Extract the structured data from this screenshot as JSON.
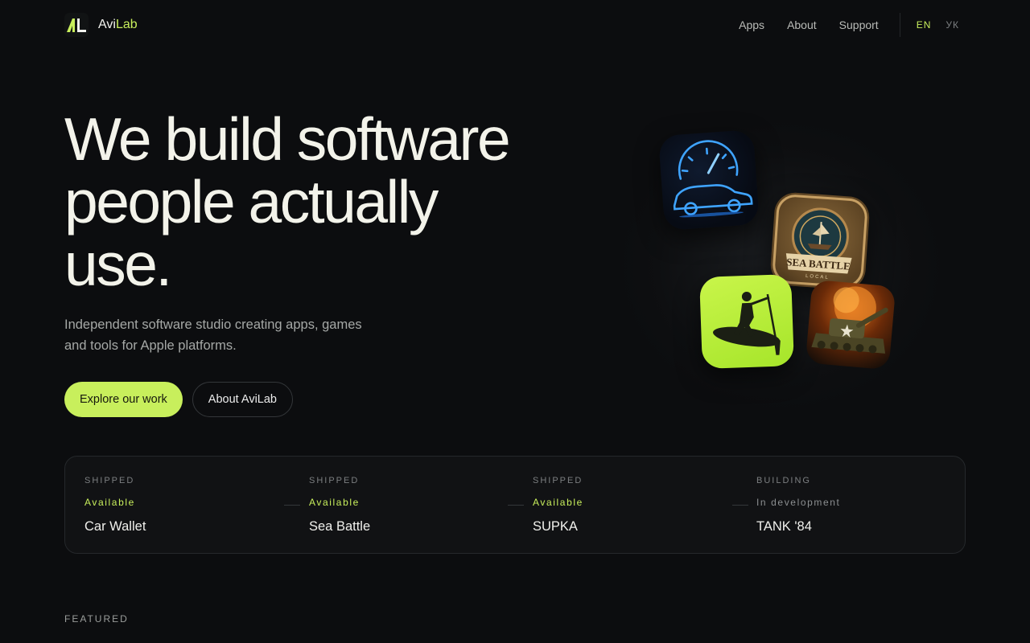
{
  "brand": {
    "prefix": "Avi",
    "suffix": "Lab",
    "logo_icon": "al-logo-icon"
  },
  "nav": {
    "links": [
      "Apps",
      "About",
      "Support"
    ],
    "languages": [
      "EN",
      "УК"
    ],
    "active_language": "EN"
  },
  "hero": {
    "title_lines": [
      "We build software",
      "people actually",
      "use."
    ],
    "subtitle": "Independent software studio creating apps, games and tools for Apple platforms.",
    "primary_cta": "Explore our work",
    "secondary_cta": "About AviLab"
  },
  "showcase": {
    "icons": [
      "car-wallet-icon",
      "sea-battle-icon",
      "supka-icon",
      "tank-84-icon"
    ],
    "sea_battle_text": "SEA BATTLE",
    "sea_battle_subtext": "LOCAL"
  },
  "status": [
    {
      "kind": "SHIPPED",
      "state": "Available",
      "name": "Car Wallet"
    },
    {
      "kind": "SHIPPED",
      "state": "Available",
      "name": "Sea Battle"
    },
    {
      "kind": "SHIPPED",
      "state": "Available",
      "name": "SUPKA"
    },
    {
      "kind": "BUILDING",
      "state": "In development",
      "name": "TANK '84"
    }
  ],
  "featured_label": "FEATURED",
  "colors": {
    "accent": "#c8ef5c",
    "background": "#0c0d0f"
  }
}
